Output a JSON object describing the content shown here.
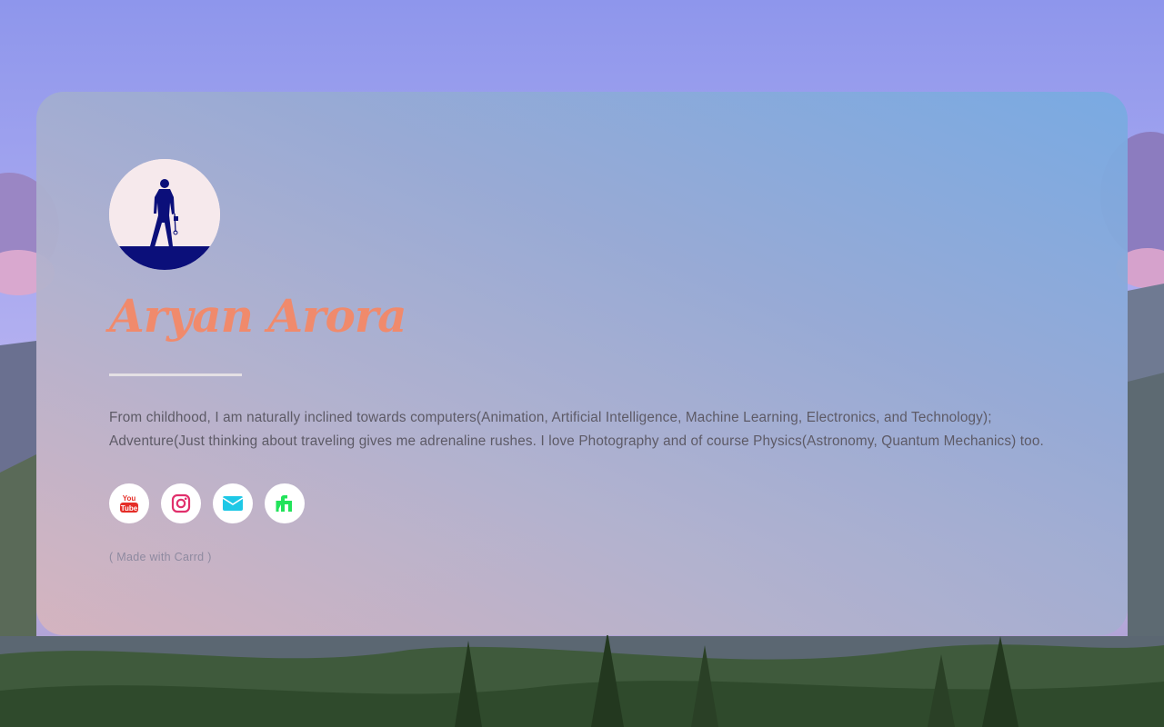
{
  "profile": {
    "name": "Aryan Arora",
    "bio": "From childhood, I am naturally inclined towards computers(Animation, Artificial Intelligence, Machine Learning, Electronics, and Technology); Adventure(Just thinking about traveling gives me adrenaline rushes. I love Photography and of course Physics(Astronomy, Quantum Mechanics) too.",
    "avatar_icon": "silhouette-photographer"
  },
  "social": [
    {
      "name": "YouTube",
      "icon": "youtube-icon",
      "color": "#e52d27"
    },
    {
      "name": "Instagram",
      "icon": "instagram-icon",
      "color": "#e1306c"
    },
    {
      "name": "Email",
      "icon": "envelope-icon",
      "color": "#1ec8e6"
    },
    {
      "name": "Fiverr / Fundable",
      "icon": "fundable-icon",
      "color": "#22e35a"
    }
  ],
  "footer": {
    "credit": "( Made with Carrd )"
  },
  "colors": {
    "name_accent": "#f08a6c",
    "card_gradient_start": "#d6b4be",
    "card_gradient_end": "#78aae2",
    "avatar_bg": "#f6e9ec",
    "avatar_silhouette": "#0b0f7a"
  }
}
